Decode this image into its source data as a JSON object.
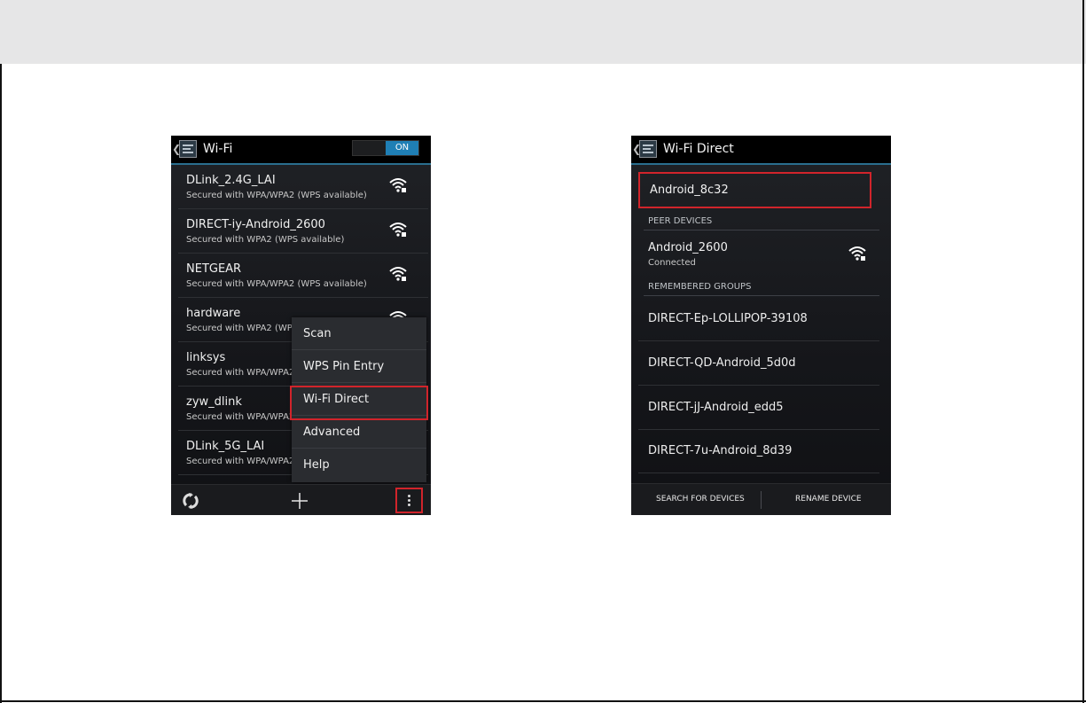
{
  "wifi_screen": {
    "title": "Wi-Fi",
    "toggle_label": "ON",
    "networks": [
      {
        "name": "DLink_2.4G_LAI",
        "security": "Secured with WPA/WPA2 (WPS available)"
      },
      {
        "name": "DIRECT-iy-Android_2600",
        "security": "Secured with WPA2 (WPS available)"
      },
      {
        "name": "NETGEAR",
        "security": "Secured with WPA/WPA2 (WPS available)"
      },
      {
        "name": "hardware",
        "security": "Secured with WPA2 (WPS"
      },
      {
        "name": "linksys",
        "security": "Secured with WPA/WPA2"
      },
      {
        "name": "zyw_dlink",
        "security": "Secured with WPA/WPA2"
      },
      {
        "name": "DLink_5G_LAI",
        "security": "Secured with WPA/WPA2"
      }
    ],
    "menu": [
      "Scan",
      "WPS Pin Entry",
      "Wi-Fi Direct",
      "Advanced",
      "Help"
    ],
    "highlighted_menu_item": "Wi-Fi Direct"
  },
  "wifi_direct_screen": {
    "title": "Wi-Fi Direct",
    "device_name": "Android_8c32",
    "peer_header": "PEER DEVICES",
    "peer": {
      "name": "Android_2600",
      "status": "Connected"
    },
    "groups_header": "REMEMBERED GROUPS",
    "groups": [
      "DIRECT-Ep-LOLLIPOP-39108",
      "DIRECT-QD-Android_5d0d",
      "DIRECT-jJ-Android_edd5",
      "DIRECT-7u-Android_8d39"
    ],
    "buttons": {
      "search": "SEARCH FOR DEVICES",
      "rename": "RENAME DEVICE"
    }
  },
  "colors": {
    "accent_blue": "#1f7fb5",
    "highlight_red": "#d1242b"
  }
}
